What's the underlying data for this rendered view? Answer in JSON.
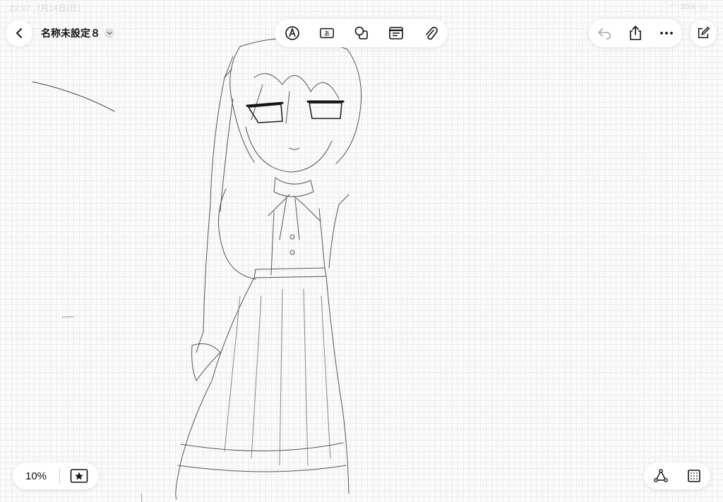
{
  "status_bar": {
    "time": "22:07",
    "date": "7月14日(日)",
    "battery": "20%"
  },
  "header": {
    "back_icon": "chevron-left-icon",
    "title": "名称未設定８"
  },
  "toolbar": {
    "tools": [
      "pen-tip-icon",
      "text-box-icon",
      "shapes-icon",
      "sticky-note-icon",
      "paperclip-icon"
    ]
  },
  "right_toolbar": {
    "actions": [
      "undo-icon",
      "share-icon",
      "more-icon"
    ],
    "new_note_icon": "compose-icon"
  },
  "bottom": {
    "zoom": "10%",
    "favorite_icon": "star-box-icon",
    "right_icons": [
      "connector-icon",
      "grid-icon"
    ]
  },
  "colors": {
    "canvas": "#fbfbfb",
    "grid": "#ececec",
    "stroke": "#555555"
  }
}
